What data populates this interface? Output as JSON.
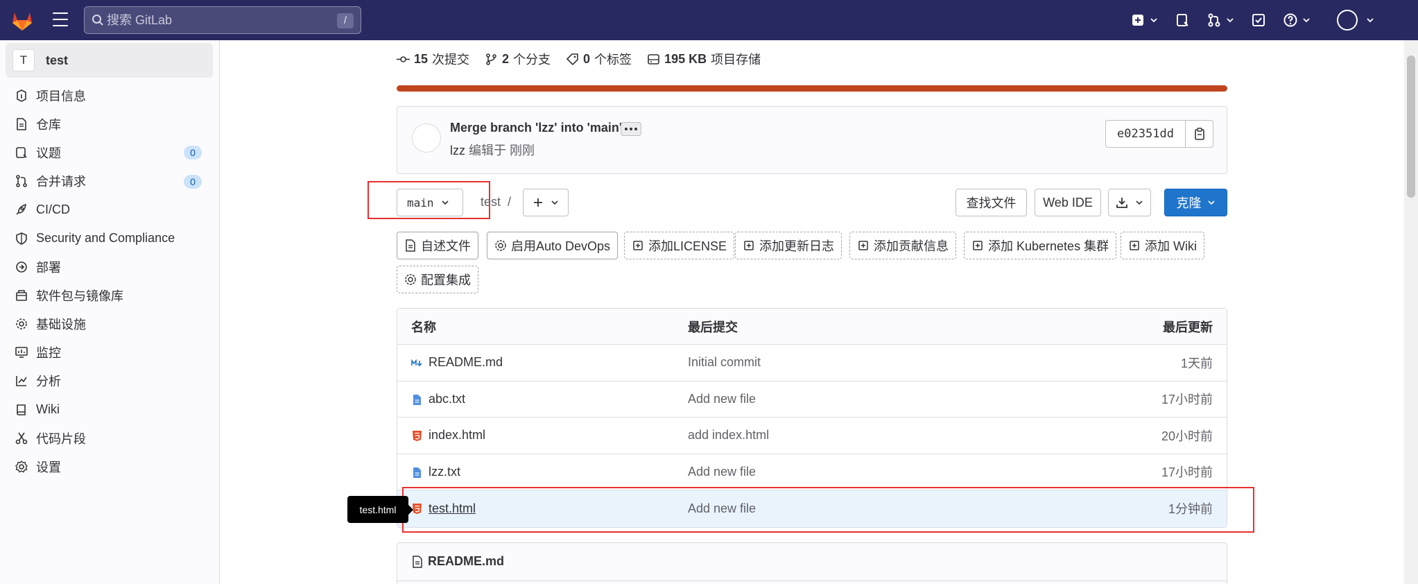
{
  "topbar": {
    "search_placeholder": "搜索 GitLab",
    "search_shortcut": "/"
  },
  "sidebar": {
    "project_initial": "T",
    "project_name": "test",
    "items": [
      {
        "label": "项目信息",
        "icon": "info-icon"
      },
      {
        "label": "仓库",
        "icon": "doc-icon"
      },
      {
        "label": "议题",
        "icon": "issues-icon",
        "count": "0"
      },
      {
        "label": "合并请求",
        "icon": "merge-request-icon",
        "count": "0"
      },
      {
        "label": "CI/CD",
        "icon": "rocket-icon"
      },
      {
        "label": "Security and Compliance",
        "icon": "shield-icon"
      },
      {
        "label": "部署",
        "icon": "deployments-icon"
      },
      {
        "label": "软件包与镜像库",
        "icon": "package-icon"
      },
      {
        "label": "基础设施",
        "icon": "cloud-gear-icon"
      },
      {
        "label": "监控",
        "icon": "monitor-icon"
      },
      {
        "label": "分析",
        "icon": "chart-icon"
      },
      {
        "label": "Wiki",
        "icon": "book-icon"
      },
      {
        "label": "代码片段",
        "icon": "snippet-icon"
      },
      {
        "label": "设置",
        "icon": "settings-icon"
      }
    ]
  },
  "stats": {
    "commits_count": "15",
    "commits_label": "次提交",
    "branches_count": "2",
    "branches_label": "个分支",
    "tags_count": "0",
    "tags_label": "个标签",
    "storage_size": "195 KB",
    "storage_label": "项目存储"
  },
  "commit": {
    "title": "Merge branch 'lzz' into 'main'",
    "author": "lzz",
    "action": "编辑于",
    "time": "刚刚",
    "sha": "e02351dd"
  },
  "repo": {
    "branch": "main",
    "path": "test",
    "separator": "/",
    "find_file": "查找文件",
    "web_ide": "Web IDE",
    "clone": "克隆"
  },
  "chips": {
    "readme": "自述文件",
    "auto_devops": "启用Auto DevOps",
    "license": "添加LICENSE",
    "changelog": "添加更新日志",
    "contributing": "添加贡献信息",
    "kubernetes": "添加 Kubernetes 集群",
    "wiki": "添加 Wiki",
    "integrations": "配置集成"
  },
  "files": {
    "headers": {
      "name": "名称",
      "last_commit": "最后提交",
      "last_update": "最后更新"
    },
    "rows": [
      {
        "name": "README.md",
        "commit": "Initial commit",
        "time": "1天前",
        "icon": "markdown-icon"
      },
      {
        "name": "abc.txt",
        "commit": "Add new file",
        "time": "17小时前",
        "icon": "text-file-icon"
      },
      {
        "name": "index.html",
        "commit": "add index.html",
        "time": "20小时前",
        "icon": "html-file-icon"
      },
      {
        "name": "lzz.txt",
        "commit": "Add new file",
        "time": "17小时前",
        "icon": "text-file-icon"
      },
      {
        "name": "test.html",
        "commit": "Add new file",
        "time": "1分钟前",
        "icon": "html-file-icon"
      }
    ]
  },
  "tooltip": "test.html",
  "readme_title": "README.md",
  "colors": {
    "topbar": "#292961",
    "language_bar": "#c0451e",
    "primary": "#1f75cb",
    "annotation": "#e8302f"
  }
}
